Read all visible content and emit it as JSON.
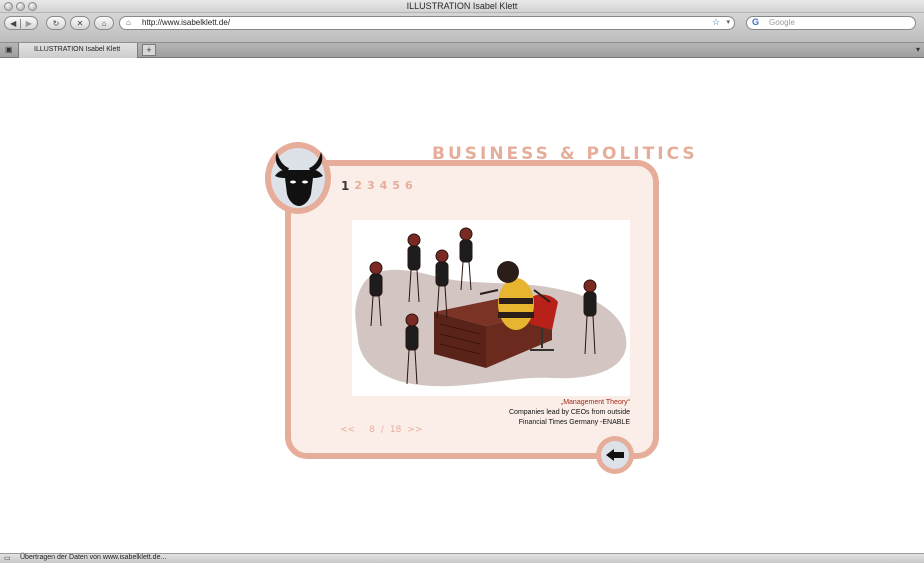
{
  "window": {
    "title": "ILLUSTRATION Isabel Klett"
  },
  "toolbar": {
    "url": "http://www.isabelklett.de/",
    "search_placeholder": "Google"
  },
  "tabs": [
    {
      "label": "ILLUSTRATION Isabel Klett"
    }
  ],
  "status": {
    "text": "Übertragen der Daten von www.isabelklett.de..."
  },
  "page": {
    "section_title": "BUSINESS & POLITICS",
    "page_numbers": [
      "1",
      "2",
      "3",
      "4",
      "5",
      "6"
    ],
    "active_page": "1",
    "caption": {
      "title": "„Management Theory“",
      "line1": "Companies lead by CEOs from outside",
      "line2": "Financial Times Germany -ENABLE"
    },
    "pager": {
      "prev": "<<",
      "current": "8",
      "separator": "/",
      "total": "18",
      "next": ">>"
    }
  },
  "colors": {
    "accent": "#e6ae9a",
    "panel": "#fbeee9",
    "caption_title": "#a02a1a"
  }
}
